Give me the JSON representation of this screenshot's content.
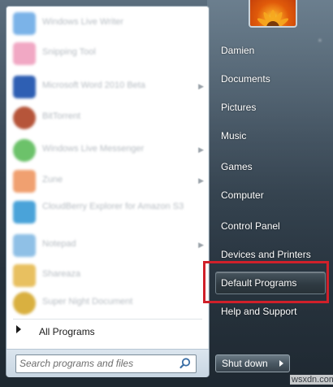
{
  "programs": [
    {
      "label": "Windows Live Writer",
      "icon_color": "#7bb3e8",
      "has_arrow": false
    },
    {
      "label": "Snipping Tool",
      "icon_color": "#f1a8c4",
      "has_arrow": false
    },
    {
      "label": "Microsoft Word 2010 Beta",
      "icon_color": "#2e5fb3",
      "has_arrow": true
    },
    {
      "label": "BitTorrent",
      "icon_color": "#b6553a",
      "has_arrow": false
    },
    {
      "label": "Windows Live Messenger",
      "icon_color": "#6cc26a",
      "has_arrow": true
    },
    {
      "label": "Zune",
      "icon_color": "#f0a070",
      "has_arrow": true
    },
    {
      "label": "CloudBerry Explorer for Amazon S3",
      "icon_color": "#4aa3d9",
      "has_arrow": false
    },
    {
      "label": "Notepad",
      "icon_color": "#8fc0e6",
      "has_arrow": true
    },
    {
      "label": "Shareaza",
      "icon_color": "#e8c060",
      "has_arrow": false
    },
    {
      "label": "Super Night Document",
      "icon_color": "#d9b040",
      "has_arrow": false
    }
  ],
  "all_programs_label": "All Programs",
  "search": {
    "placeholder": "Search programs and files"
  },
  "right_links": [
    {
      "label": "Damien"
    },
    {
      "label": "Documents"
    },
    {
      "label": "Pictures"
    },
    {
      "label": "Music"
    },
    {
      "label": "Games"
    },
    {
      "label": "Computer"
    },
    {
      "label": "Control Panel"
    },
    {
      "label": "Devices and Printers"
    },
    {
      "label": "Default Programs",
      "selected": true
    },
    {
      "label": "Help and Support"
    }
  ],
  "shutdown_label": "Shut down",
  "watermark": "wsxdn.com",
  "colors": {
    "highlight": "#d0202a",
    "selected_bg": "#2f3a42"
  }
}
